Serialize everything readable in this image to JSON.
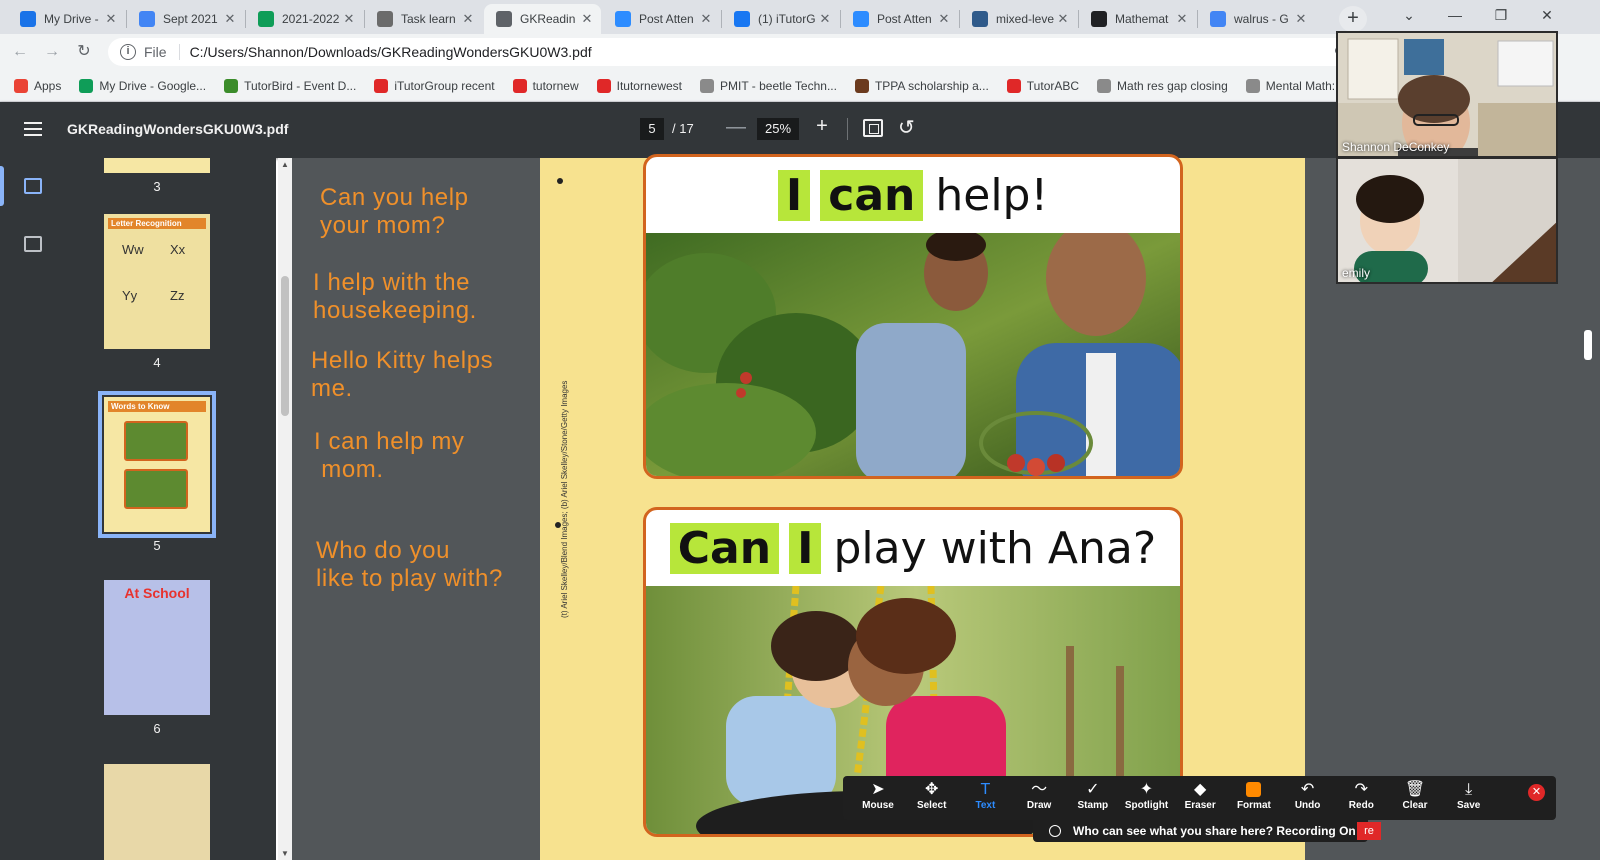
{
  "browser": {
    "tabs": [
      {
        "label": "My Drive -",
        "icon": "google-drive-icon",
        "color": "#1a73e8"
      },
      {
        "label": "Sept 2021",
        "icon": "google-docs-icon",
        "color": "#4285f4"
      },
      {
        "label": "2021-2022",
        "icon": "google-sheets-icon",
        "color": "#0f9d58"
      },
      {
        "label": "Task learn",
        "icon": "task-icon",
        "color": "#6b6b6b"
      },
      {
        "label": "GKReadin",
        "icon": "pdf-globe-icon",
        "color": "#5f6368"
      },
      {
        "label": "Post Atten",
        "icon": "zoom-icon",
        "color": "#2d8cff"
      },
      {
        "label": "(1) iTutorG",
        "icon": "facebook-icon",
        "color": "#1877f2"
      },
      {
        "label": "Post Atten",
        "icon": "zoom-icon",
        "color": "#2d8cff"
      },
      {
        "label": "mixed-leve",
        "icon": "merriam-webster-icon",
        "color": "#2f5a8a"
      },
      {
        "label": "Mathemat",
        "icon": "wolfram-icon",
        "color": "#202124"
      },
      {
        "label": "walrus - G",
        "icon": "google-icon",
        "color": "#4285f4"
      }
    ],
    "active_tab_index": 4,
    "nav": {
      "scheme_label": "File",
      "url": "C:/Users/Shannon/Downloads/GKReadingWondersGKU0W3.pdf"
    },
    "bookmarks": [
      {
        "label": "Apps",
        "icon": "apps-grid-icon",
        "color": "#ea4335"
      },
      {
        "label": "My Drive - Google...",
        "icon": "google-drive-icon",
        "color": "#0f9d58"
      },
      {
        "label": "TutorBird - Event D...",
        "icon": "tutorbird-icon",
        "color": "#3b8c2a"
      },
      {
        "label": "iTutorGroup recent",
        "icon": "itutor-icon",
        "color": "#e02828"
      },
      {
        "label": "tutornew",
        "icon": "itutor-icon",
        "color": "#e02828"
      },
      {
        "label": "Itutornewest",
        "icon": "itutor-icon",
        "color": "#e02828"
      },
      {
        "label": "PMIT - beetle Techn...",
        "icon": "globe-icon",
        "color": "#8a8a8a"
      },
      {
        "label": "TPPA scholarship a...",
        "icon": "tppa-icon",
        "color": "#6b3a1e"
      },
      {
        "label": "TutorABC",
        "icon": "itutor-icon",
        "color": "#e02828"
      },
      {
        "label": "Math res gap closing",
        "icon": "globe-icon",
        "color": "#8a8a8a"
      },
      {
        "label": "Mental Math: C",
        "icon": "globe-icon",
        "color": "#8a8a8a"
      }
    ]
  },
  "pdf": {
    "filename": "GKReadingWondersGKU0W3.pdf",
    "current_page": "5",
    "total_pages": "/ 17",
    "zoom": "25%",
    "thumbnails": [
      {
        "label": "3"
      },
      {
        "label": "4",
        "title": "Letter Recognition",
        "letters": [
          "Ww",
          "Xx",
          "Yy",
          "Zz"
        ]
      },
      {
        "label": "5",
        "selected": true,
        "title": "Words to Know"
      },
      {
        "label": "6",
        "title": "At School"
      },
      {
        "label": ""
      }
    ],
    "page": {
      "card1": {
        "word1": "I",
        "word2": "can",
        "rest": "help!"
      },
      "card2": {
        "word1": "Can",
        "word2": "I",
        "rest": "play with Ana?"
      },
      "credit": "(t) Ariel Skelley/Blend Images; (b) Ariel Skelley/Stone/Getty Images"
    }
  },
  "annotations": {
    "notes": [
      "Can you help\nyour mom?",
      "I help with the\nhousekeeping.",
      "Hello Kitty helps\nme.",
      "I can help my\n mom.",
      "Who do you\nlike to play with?"
    ],
    "color": "#f0902a"
  },
  "zoom_meeting": {
    "participants": [
      {
        "name": "Shannon DeConkey"
      },
      {
        "name": "emily"
      }
    ],
    "toolbar": [
      {
        "label": "Mouse",
        "icon": "mouse-pointer-icon",
        "glyph": "➤"
      },
      {
        "label": "Select",
        "icon": "move-select-icon",
        "glyph": "✥"
      },
      {
        "label": "Text",
        "icon": "text-icon",
        "glyph": "T",
        "active": true
      },
      {
        "label": "Draw",
        "icon": "draw-squiggle-icon",
        "glyph": "〜"
      },
      {
        "label": "Stamp",
        "icon": "checkmark-stamp-icon",
        "glyph": "✓"
      },
      {
        "label": "Spotlight",
        "icon": "spotlight-wand-icon",
        "glyph": "✦"
      },
      {
        "label": "Eraser",
        "icon": "eraser-icon",
        "glyph": "◆"
      },
      {
        "label": "Format",
        "icon": "format-color-icon",
        "glyph": ""
      },
      {
        "label": "Undo",
        "icon": "undo-icon",
        "glyph": "↶"
      },
      {
        "label": "Redo",
        "icon": "redo-icon",
        "glyph": "↷"
      },
      {
        "label": "Clear",
        "icon": "trash-icon",
        "glyph": "🗑"
      },
      {
        "label": "Save",
        "icon": "save-download-icon",
        "glyph": "⤓"
      }
    ],
    "share_notice": "Who can see what you share here? Recording On",
    "recording_badge": "re",
    "close_glyph": "✕"
  }
}
